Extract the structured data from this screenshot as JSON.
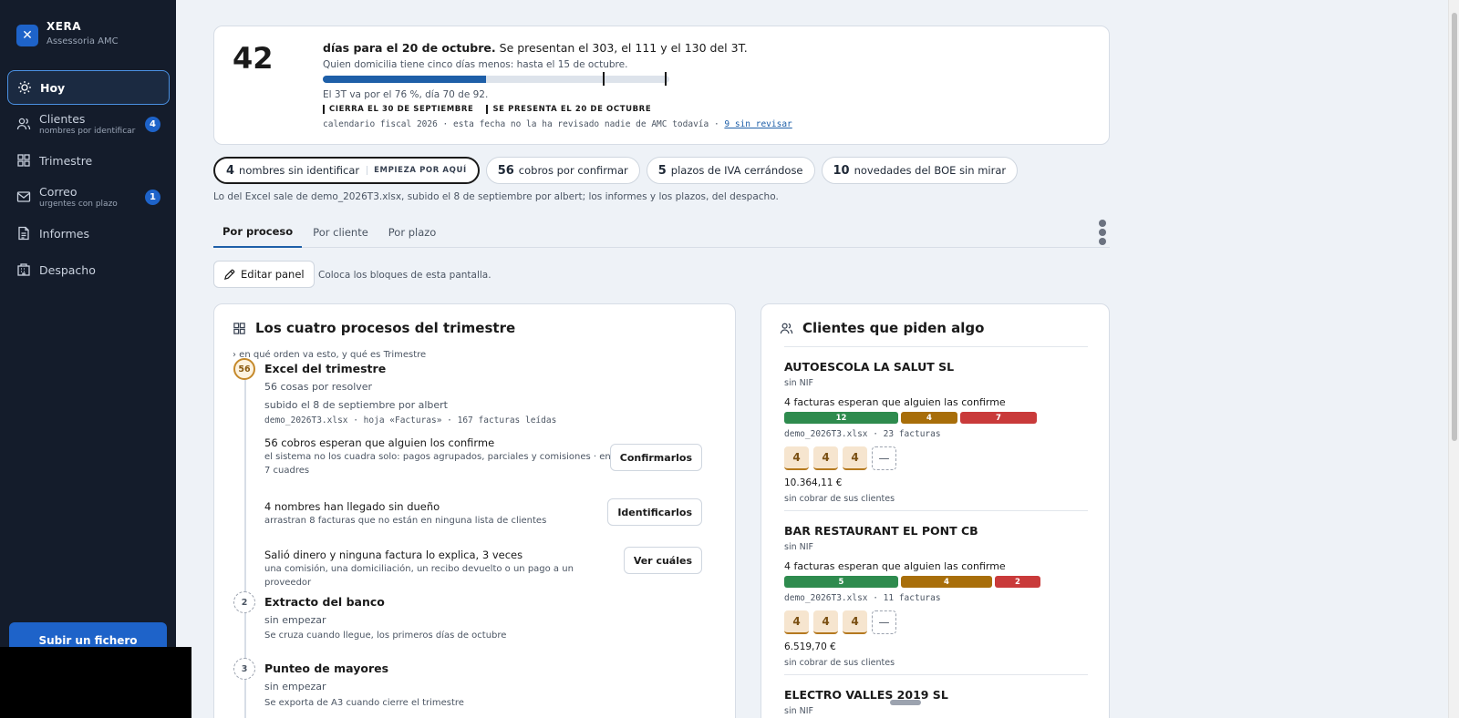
{
  "brand": {
    "name": "XERA",
    "subtitle": "Assessoria AMC",
    "logo_icon": "close-icon"
  },
  "sidebar": {
    "items": [
      {
        "label": "Hoy",
        "sub": "",
        "badge": "",
        "icon": "sun-icon",
        "active": true
      },
      {
        "label": "Clientes",
        "sub": "nombres por identificar",
        "badge": "4",
        "icon": "users-icon"
      },
      {
        "label": "Trimestre",
        "sub": "",
        "badge": "",
        "icon": "grid-icon"
      },
      {
        "label": "Correo",
        "sub": "urgentes con plazo",
        "badge": "1",
        "icon": "mail-icon"
      },
      {
        "label": "Informes",
        "sub": "",
        "badge": "",
        "icon": "document-icon"
      },
      {
        "label": "Despacho",
        "sub": "",
        "badge": "",
        "icon": "building-icon"
      }
    ],
    "upload_label": "Subir un fichero"
  },
  "countdown": {
    "days": "42",
    "title_bold": "días para el 20 de octubre.",
    "title_rest": " Se presentan el 303, el 111 y el 130 del 3T.",
    "note": "Quien domicilia tiene cinco días menos: hasta el 15 de octubre.",
    "progress_percent": 76,
    "progress_text": "El 3T va por el 76 %, día 70 de 92.",
    "marker_close": "CIERRA EL 30 DE SEPTIEMBRE",
    "marker_present": "SE PRESENTA EL 20 DE OCTUBRE",
    "source_text": "calendario fiscal 2026 · esta fecha no la ha revisado nadie de AMC todavía · ",
    "source_link": "9 sin revisar"
  },
  "pills": [
    {
      "count": "4",
      "label": "nombres sin identificar",
      "tag": "EMPIEZA POR AQUÍ",
      "active": true
    },
    {
      "count": "56",
      "label": "cobros por confirmar",
      "tag": ""
    },
    {
      "count": "5",
      "label": "plazos de IVA cerrándose",
      "tag": ""
    },
    {
      "count": "10",
      "label": "novedades del BOE sin mirar",
      "tag": ""
    }
  ],
  "excel_note": "Lo del Excel sale de demo_2026T3.xlsx, subido el 8 de septiembre por albert; los informes y los plazos, del despacho.",
  "tabs": [
    {
      "label": "Por proceso",
      "active": true
    },
    {
      "label": "Por cliente"
    },
    {
      "label": "Por plazo"
    }
  ],
  "edit": {
    "button_label": "Editar panel",
    "note": "Coloca los bloques de esta pantalla."
  },
  "procesos": {
    "title": "Los cuatro procesos del trimestre",
    "orden_link": "› en qué orden va esto, y qué es Trimestre",
    "steps": [
      {
        "num": "56",
        "title": "Excel del trimestre",
        "meta1": "56 cosas por resolver",
        "meta2": "subido el 8 de septiembre por albert",
        "mono": "demo_2026T3.xlsx · hoja «Facturas» · 167 facturas leídas"
      },
      {
        "num": "2",
        "title": "Extracto del banco",
        "meta1": "sin empezar",
        "meta2": "Se cruza cuando llegue, los primeros días de octubre"
      },
      {
        "num": "3",
        "title": "Punteo de mayores",
        "meta1": "sin empezar",
        "meta2": "Se exporta de A3 cuando cierre el trimestre"
      }
    ],
    "tasks": [
      {
        "title": "56 cobros esperan que alguien los confirme",
        "desc": "el sistema no los cuadra solo: pagos agrupados, parciales y comisiones · en 7 cuadres",
        "button": "Confirmarlos"
      },
      {
        "title": "4 nombres han llegado sin dueño",
        "desc": "arrastran 8 facturas que no están en ninguna lista de clientes",
        "button": "Identificarlos"
      },
      {
        "title": "Salió dinero y ninguna factura lo explica, 3 veces",
        "desc": "una comisión, una domiciliación, un recibo devuelto o un pago a un proveedor",
        "button": "Ver cuáles"
      }
    ]
  },
  "clientes": {
    "title": "Clientes que piden algo",
    "items": [
      {
        "name": "AUTOESCOLA LA SALUT SL",
        "nif": "sin NIF",
        "wait": "4 facturas esperan que alguien las confirme",
        "segments": [
          {
            "value": "12",
            "color": "#2e8b4e"
          },
          {
            "value": "4",
            "color": "#a86e0a"
          },
          {
            "value": "7",
            "color": "#c93a3a"
          }
        ],
        "file": "demo_2026T3.xlsx · 23 facturas",
        "chips": [
          "4",
          "4",
          "4",
          "—"
        ],
        "amount": "10.364,11 €",
        "amount_note": "sin cobrar de sus clientes"
      },
      {
        "name": "BAR RESTAURANT EL PONT CB",
        "nif": "sin NIF",
        "wait": "4 facturas esperan que alguien las confirme",
        "segments": [
          {
            "value": "5",
            "color": "#2e8b4e"
          },
          {
            "value": "4",
            "color": "#a86e0a"
          },
          {
            "value": "2",
            "color": "#c93a3a"
          }
        ],
        "file": "demo_2026T3.xlsx · 11 facturas",
        "chips": [
          "4",
          "4",
          "4",
          "—"
        ],
        "amount": "6.519,70 €",
        "amount_note": "sin cobrar de sus clientes"
      },
      {
        "name": "ELECTRO VALLES 2019 SL",
        "nif": "sin NIF"
      }
    ]
  }
}
